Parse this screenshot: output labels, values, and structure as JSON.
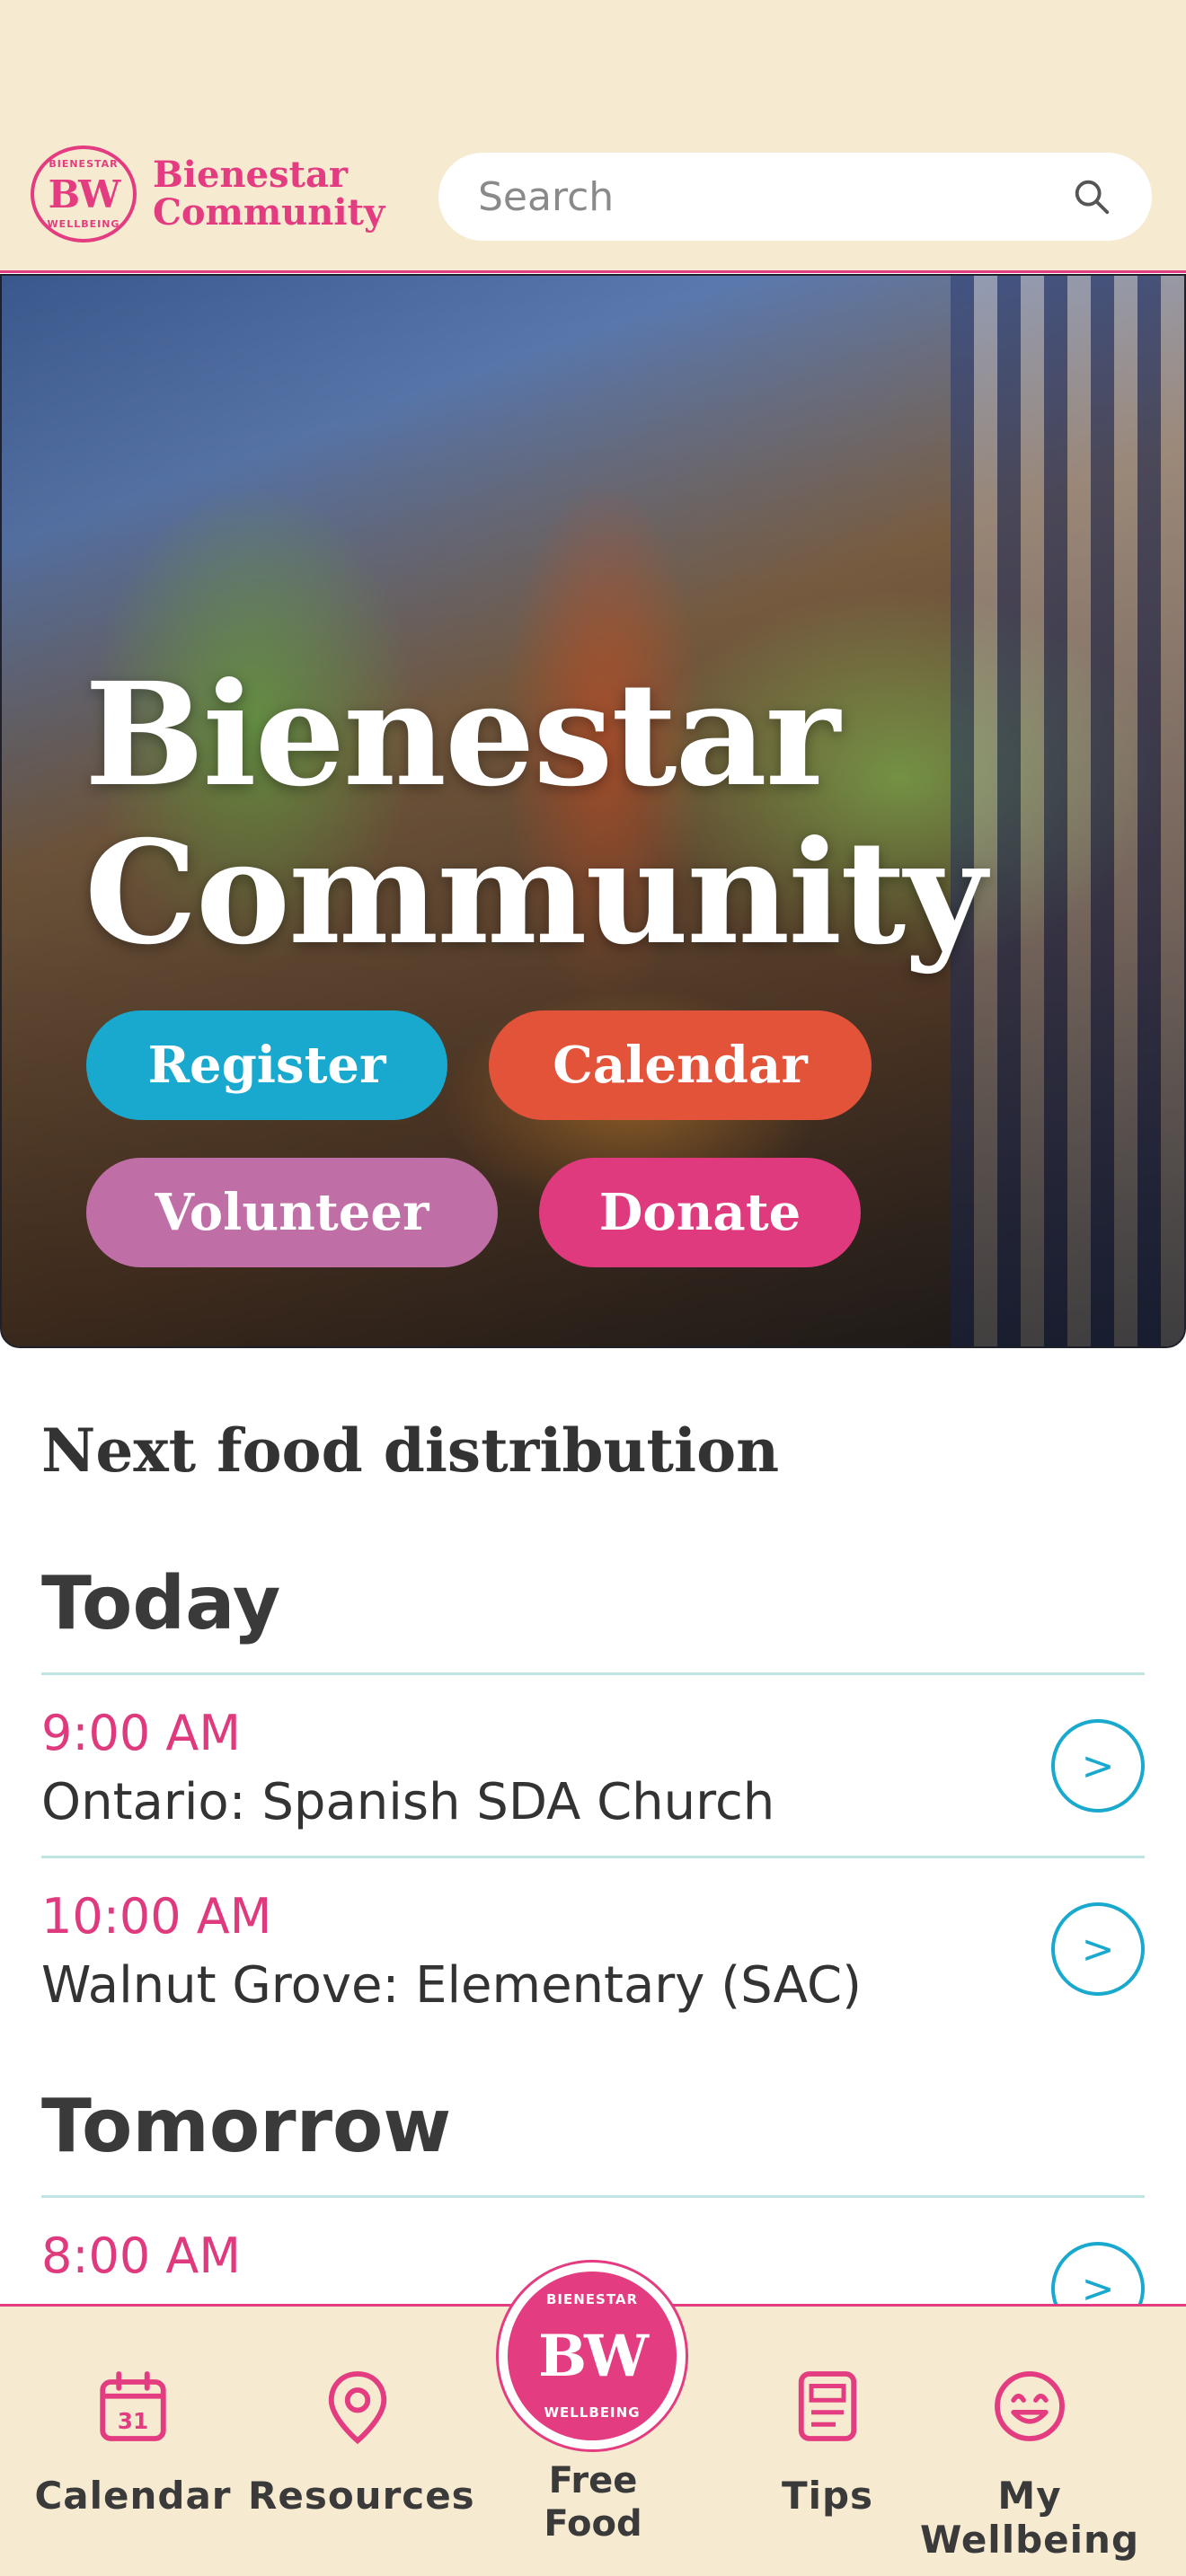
{
  "header": {
    "logo_badge": "BW",
    "logo_ring_top": "BIENESTAR",
    "logo_ring_bottom": "WELLBEING",
    "logo_text_line1": "Bienestar",
    "logo_text_line2": "Community",
    "search_placeholder": "Search"
  },
  "hero": {
    "title_line1": "Bienestar",
    "title_line2": "Community",
    "buttons": {
      "register": "Register",
      "calendar": "Calendar",
      "volunteer": "Volunteer",
      "donate": "Donate"
    }
  },
  "distribution": {
    "title": "Next food distribution",
    "days": [
      {
        "label": "Today",
        "events": [
          {
            "time": "9:00 AM",
            "place": "Ontario: Spanish SDA Church"
          },
          {
            "time": "10:00 AM",
            "place": "Walnut Grove: Elementary (SAC)"
          }
        ]
      },
      {
        "label": "Tomorrow",
        "events": [
          {
            "time": "8:00 AM",
            "place": ""
          }
        ]
      }
    ],
    "go_glyph": ">"
  },
  "bottom_nav": {
    "items": [
      {
        "label": "Calendar",
        "icon": "calendar-icon",
        "icon_text": "31"
      },
      {
        "label": "Resources",
        "icon": "location-pin-icon"
      },
      {
        "label_line1": "Free",
        "label_line2": "Food",
        "icon": "bw-logo-icon"
      },
      {
        "label": "Tips",
        "icon": "document-icon"
      },
      {
        "label": "My Wellbeing",
        "icon": "smile-icon"
      }
    ]
  },
  "colors": {
    "brand_pink": "#e43c80",
    "teal": "#1aa9ce",
    "cream": "#f6ead1",
    "orange_red": "#e2533a",
    "mauve": "#c06fa6"
  }
}
